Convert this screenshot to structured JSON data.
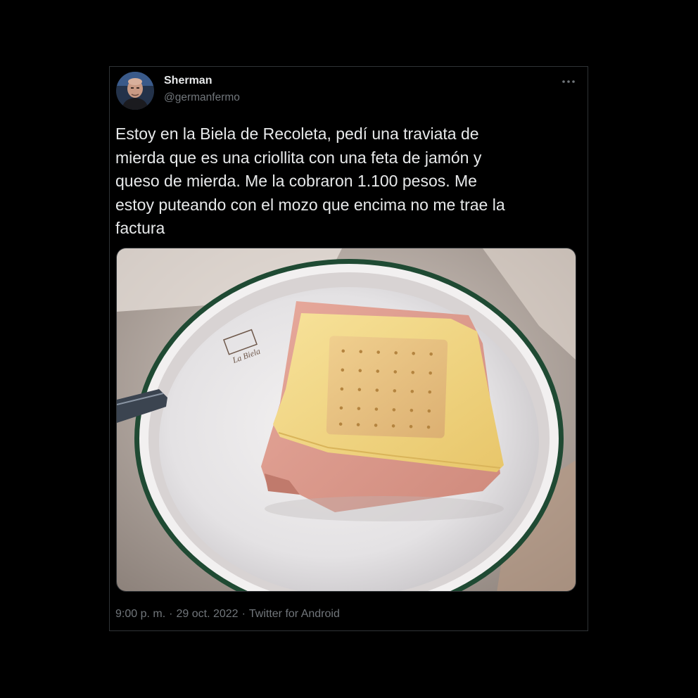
{
  "tweet": {
    "author": {
      "display_name": "Sherman",
      "handle": "@germanfermo",
      "avatar_icon": "profile-photo"
    },
    "more_icon": "more-horizontal-icon",
    "text": "Estoy en la Biela de Recoleta, pedí una traviata de\nmierda que es una criollita con una feta de jamón y\nqueso de mierda. Me la cobraron 1.100 pesos. Me\nestoy puteando con el mozo que encima no me trae la\nfactura",
    "photo": {
      "plate_logo_text": "La Biela"
    },
    "meta": {
      "time": "9:00 p. m.",
      "separator": "·",
      "date": "29 oct. 2022",
      "source": "Twitter for Android"
    }
  },
  "colors": {
    "background": "#000000",
    "text_primary": "#e7e9ea",
    "text_secondary": "#71767b",
    "border": "#2f3336"
  }
}
